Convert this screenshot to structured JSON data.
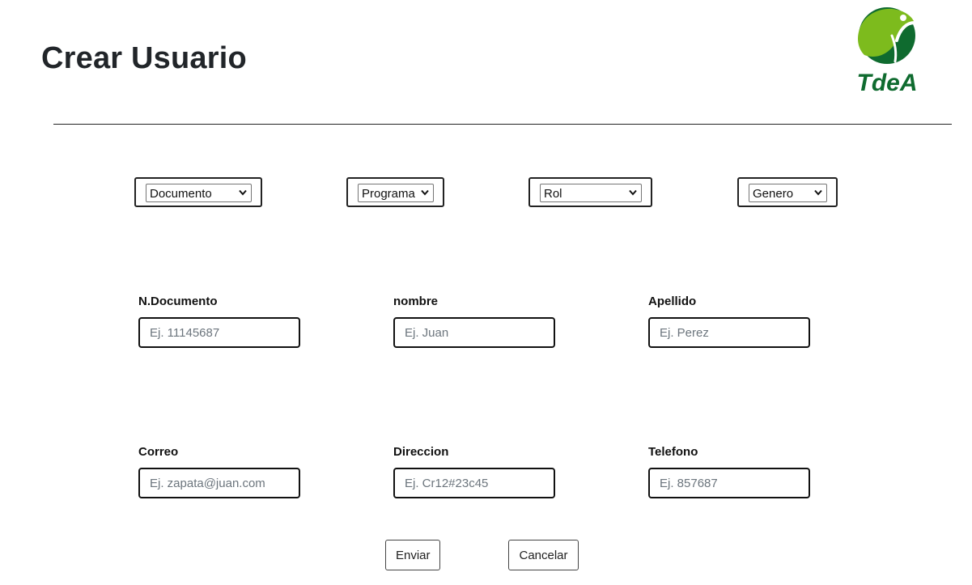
{
  "page": {
    "title": "Crear Usuario",
    "logo_text": "TdeA"
  },
  "colors": {
    "logo_dark_green": "#0f6b2f",
    "logo_light_green": "#7dbb1d",
    "text": "#212529",
    "placeholder": "#6c757d"
  },
  "selects": {
    "documento": "Documento",
    "programa": "Programa",
    "rol": "Rol",
    "genero": "Genero"
  },
  "fields": {
    "documento": {
      "label": "N.Documento",
      "placeholder": "Ej. 11145687"
    },
    "nombre": {
      "label": "nombre",
      "placeholder": "Ej. Juan"
    },
    "apellido": {
      "label": "Apellido",
      "placeholder": "Ej. Perez"
    },
    "correo": {
      "label": "Correo",
      "placeholder": "Ej. zapata@juan.com"
    },
    "direccion": {
      "label": "Direccion",
      "placeholder": "Ej. Cr12#23c45"
    },
    "telefono": {
      "label": "Telefono",
      "placeholder": "Ej. 857687"
    }
  },
  "buttons": {
    "submit": "Enviar",
    "cancel": "Cancelar"
  }
}
